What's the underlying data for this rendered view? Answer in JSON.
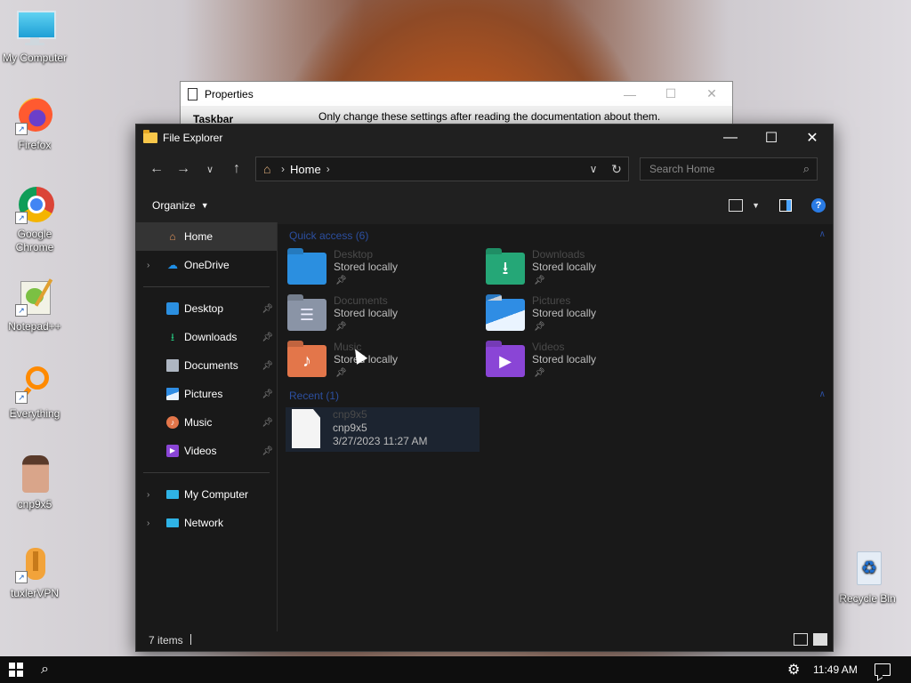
{
  "desktop": {
    "icons": [
      {
        "label": "My Computer"
      },
      {
        "label": "Firefox"
      },
      {
        "label": "Google Chrome"
      },
      {
        "label": "Notepad++"
      },
      {
        "label": "Everything"
      },
      {
        "label": "cnp9x5"
      },
      {
        "label": "tuxlerVPN"
      },
      {
        "label": "Recycle Bin"
      }
    ]
  },
  "properties_window": {
    "title": "Properties",
    "tab": "Taskbar",
    "note": "Only change these settings after reading the documentation about them."
  },
  "explorer": {
    "title": "File Explorer",
    "address": {
      "crumb": "Home"
    },
    "search": {
      "placeholder": "Search Home"
    },
    "toolbar": {
      "organize_label": "Organize"
    },
    "nav": {
      "home": "Home",
      "onedrive": "OneDrive",
      "pinned": [
        {
          "label": "Desktop"
        },
        {
          "label": "Downloads"
        },
        {
          "label": "Documents"
        },
        {
          "label": "Pictures"
        },
        {
          "label": "Music"
        },
        {
          "label": "Videos"
        }
      ],
      "my_computer": "My Computer",
      "network": "Network"
    },
    "quick_access": {
      "header": "Quick access (6)",
      "items": [
        {
          "name": "Desktop",
          "sub": "Stored locally",
          "color": "#2b8fe0"
        },
        {
          "name": "Downloads",
          "sub": "Stored locally",
          "color": "#25a777"
        },
        {
          "name": "Documents",
          "sub": "Stored locally",
          "color": "#8a94a6"
        },
        {
          "name": "Pictures",
          "sub": "Stored locally",
          "color": "#2f8de4"
        },
        {
          "name": "Music",
          "sub": "Stored locally",
          "color": "#e3764a"
        },
        {
          "name": "Videos",
          "sub": "Stored locally",
          "color": "#8a45d6"
        }
      ]
    },
    "recent": {
      "header": "Recent (1)",
      "items": [
        {
          "name": "cnp9x5",
          "sub": "cnp9x5",
          "date": "3/27/2023 11:27 AM"
        }
      ]
    },
    "status": {
      "count": "7 items"
    }
  },
  "taskbar": {
    "clock": "11:49 AM"
  }
}
